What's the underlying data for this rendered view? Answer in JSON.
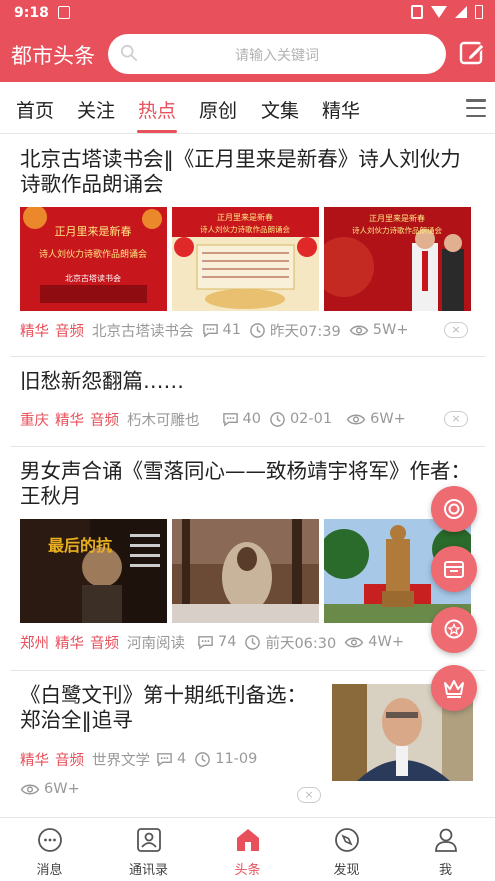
{
  "status_bar": {
    "time": "9:18"
  },
  "app_bar": {
    "title": "都市头条",
    "search_placeholder": "请输入关键词"
  },
  "tabs": [
    {
      "label": "首页"
    },
    {
      "label": "关注"
    },
    {
      "label": "热点",
      "active": true
    },
    {
      "label": "原创"
    },
    {
      "label": "文集"
    },
    {
      "label": "精华"
    }
  ],
  "articles": [
    {
      "title": "北京古塔读书会‖《正月里来是新春》诗人刘伙力诗歌作品朗诵会",
      "thumbnails": [
        {
          "caption_1": "正月里来是新春",
          "caption_2": "诗人刘伙力诗歌作品朗诵会",
          "caption_3": "北京古塔读书会"
        },
        {
          "caption_1": "正月里来是新春",
          "caption_2": "诗人刘伙力诗歌作品朗诵会"
        },
        {
          "caption_1": "正月里来是新春",
          "caption_2": "诗人刘伙力诗歌作品朗诵会"
        }
      ],
      "tags": [
        "精华",
        "音频"
      ],
      "source": "北京古塔读书会",
      "comments": "41",
      "time": "昨天07:39",
      "views": "5W+"
    },
    {
      "title": "旧愁新怨翻篇……",
      "tags": [
        "重庆",
        "精华",
        "音频"
      ],
      "source": "朽木可雕也",
      "comments": "40",
      "time": "02-01",
      "views": "6W+"
    },
    {
      "title": "男女声合诵《雪落同心——致杨靖宇将军》作者：王秋月",
      "thumbnails": [
        {
          "caption_1": "最后的抗"
        },
        {
          "caption_1": ""
        },
        {
          "caption_1": ""
        }
      ],
      "tags": [
        "郑州",
        "精华",
        "音频"
      ],
      "source": "河南阅读",
      "comments": "74",
      "time": "前天06:30",
      "views": "4W+"
    },
    {
      "title": "《白鹭文刊》第十期纸刊备选：郑治全‖追寻",
      "tags": [
        "精华",
        "音频"
      ],
      "source": "世界文学",
      "comments": "4",
      "time": "11-09",
      "views": "6W+"
    }
  ],
  "close_symbol": "×",
  "bottom_nav": [
    {
      "label": "消息",
      "icon": "chat-icon"
    },
    {
      "label": "通讯录",
      "icon": "contacts-icon"
    },
    {
      "label": "头条",
      "icon": "home-icon",
      "active": true
    },
    {
      "label": "发现",
      "icon": "compass-icon"
    },
    {
      "label": "我",
      "icon": "person-icon"
    }
  ],
  "colors": {
    "accent": "#e8505b",
    "muted": "#999999"
  }
}
